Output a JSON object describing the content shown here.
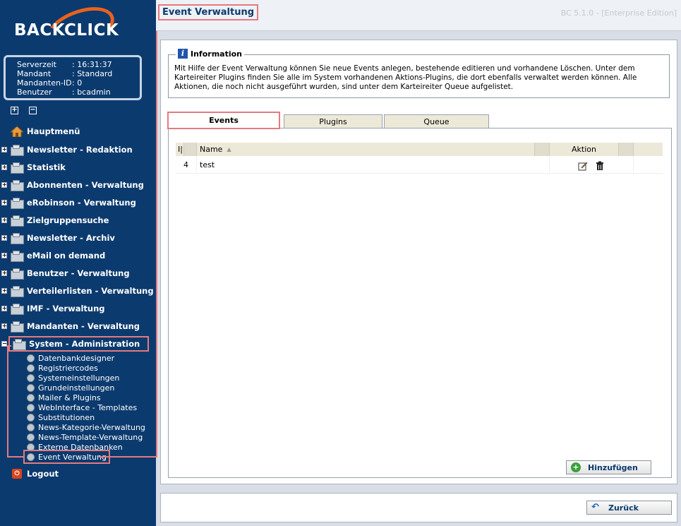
{
  "app": {
    "logo_text": "BACKCLICK",
    "page_title": "Event Verwaltung",
    "edition": "BC 5.1.0 - [Enterprise Edition]"
  },
  "colors": {
    "sidebar_bg": "#0b3a6e",
    "accent_orange": "#e8621e",
    "highlight": "#e47a80"
  },
  "server_info": [
    {
      "key": "Serverzeit",
      "value": ": 16:31:37"
    },
    {
      "key": "Mandant",
      "value": ": Standard"
    },
    {
      "key": "Mandanten-ID",
      "value": ": 0"
    },
    {
      "key": "Benutzer",
      "value": ": bcadmin"
    }
  ],
  "tree_controls": {
    "expand_all": "+",
    "collapse_all": "−"
  },
  "nav": {
    "home": "Hauptmenü",
    "items": [
      "Newsletter - Redaktion",
      "Statistik",
      "Abonnenten - Verwaltung",
      "eRobinson - Verwaltung",
      "Zielgruppensuche",
      "Newsletter - Archiv",
      "eMail on demand",
      "Benutzer - Verwaltung",
      "Verteilerlisten - Verwaltung",
      "IMF - Verwaltung",
      "Mandanten - Verwaltung"
    ],
    "expanded": "System - Administration",
    "sub_items": [
      "Datenbankdesigner",
      "Registriercodes",
      "Systemeinstellungen",
      "Grundeinstellungen",
      "Mailer & Plugins",
      "WebInterface - Templates",
      "Substitutionen",
      "News-Kategorie-Verwaltung",
      "News-Template-Verwaltung",
      "Externe Datenbanken",
      "Event Verwaltung"
    ],
    "logout": "Logout"
  },
  "info": {
    "legend": "Information",
    "text": "Mit Hilfe der Event Verwaltung können Sie neue Events anlegen, bestehende editieren und vorhandene Löschen. Unter dem Karteireiter Plugins finden Sie alle im System vorhandenen Aktions-Plugins, die dort ebenfalls verwaltet werden können. Alle Aktionen, die noch nicht ausgeführt wurden, sind unter dem Karteireiter Queue aufgelistet."
  },
  "tabs": [
    "Events",
    "Plugins",
    "Queue"
  ],
  "grid": {
    "headers": {
      "id": "I|",
      "name": "Name",
      "action": "Aktion"
    },
    "rows": [
      {
        "id": "4",
        "name": "test"
      }
    ]
  },
  "buttons": {
    "add": "Hinzufügen",
    "back": "Zurück"
  }
}
